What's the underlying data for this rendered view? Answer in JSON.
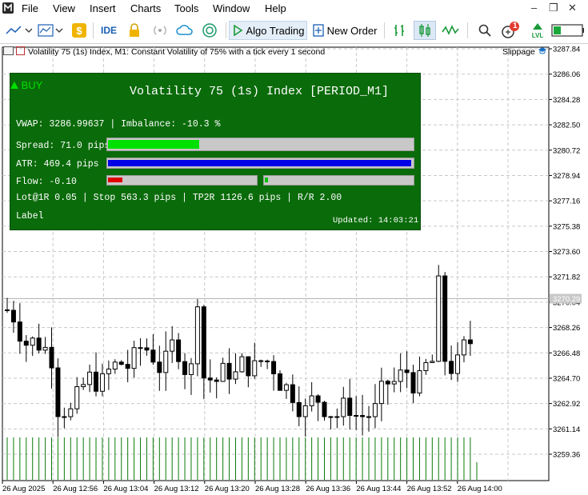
{
  "menu": {
    "items": [
      "File",
      "View",
      "Insert",
      "Charts",
      "Tools",
      "Window",
      "Help"
    ],
    "window_controls": [
      "–",
      "❐",
      "✕"
    ]
  },
  "toolbar": {
    "ide_label": "IDE",
    "algo_trading_label": "Algo Trading",
    "new_order_label": "New Order",
    "notification_count": "1",
    "lvl_label": "LVL"
  },
  "chart": {
    "title": "Volatility 75 (1s) Index, M1:  Constant Volatility of 75% with a tick every 1 second",
    "slippage_label": "Slippage",
    "price_labels": [
      "3287.84",
      "3286.06",
      "3284.28",
      "3282.50",
      "3280.72",
      "3278.94",
      "3277.16",
      "3275.38",
      "3273.60",
      "3271.82",
      "3270.04",
      "3268.26",
      "3266.48",
      "3264.70",
      "3262.92",
      "3261.14",
      "3259.36"
    ],
    "current_price": "3270.29",
    "time_labels": [
      "26 Aug 2025",
      "26 Aug 12:56",
      "26 Aug 13:04",
      "26 Aug 13:12",
      "26 Aug 13:20",
      "26 Aug 13:28",
      "26 Aug 13:36",
      "26 Aug 13:44",
      "26 Aug 13:52",
      "26 Aug 14:00"
    ]
  },
  "panel": {
    "signal": "BUY",
    "title": "Volatility 75 (1s) Index  [PERIOD_M1]",
    "vwap": "VWAP: 3286.99637  |  Imbalance: -10.3 %",
    "spread": "Spread: 71.0 pips",
    "atr": "ATR: 469.4 pips",
    "flow": "Flow: -0.10",
    "risk": "Lot@1R 0.05 | Stop 563.3 pips | TP2R 1126.6 pips | R/R 2.00",
    "label": "Label",
    "updated": "Updated: 14:03:21",
    "spread_fill": 0.3,
    "atr_fill": 1.0,
    "flow_neg_fill": 0.1,
    "flow_pos_fill": 0.02,
    "colors": {
      "bg": "#0a6b0a",
      "spread": "#00e000",
      "atr": "#0000e6",
      "flow_neg": "#e00000",
      "flow_pos": "#00c000"
    }
  }
}
